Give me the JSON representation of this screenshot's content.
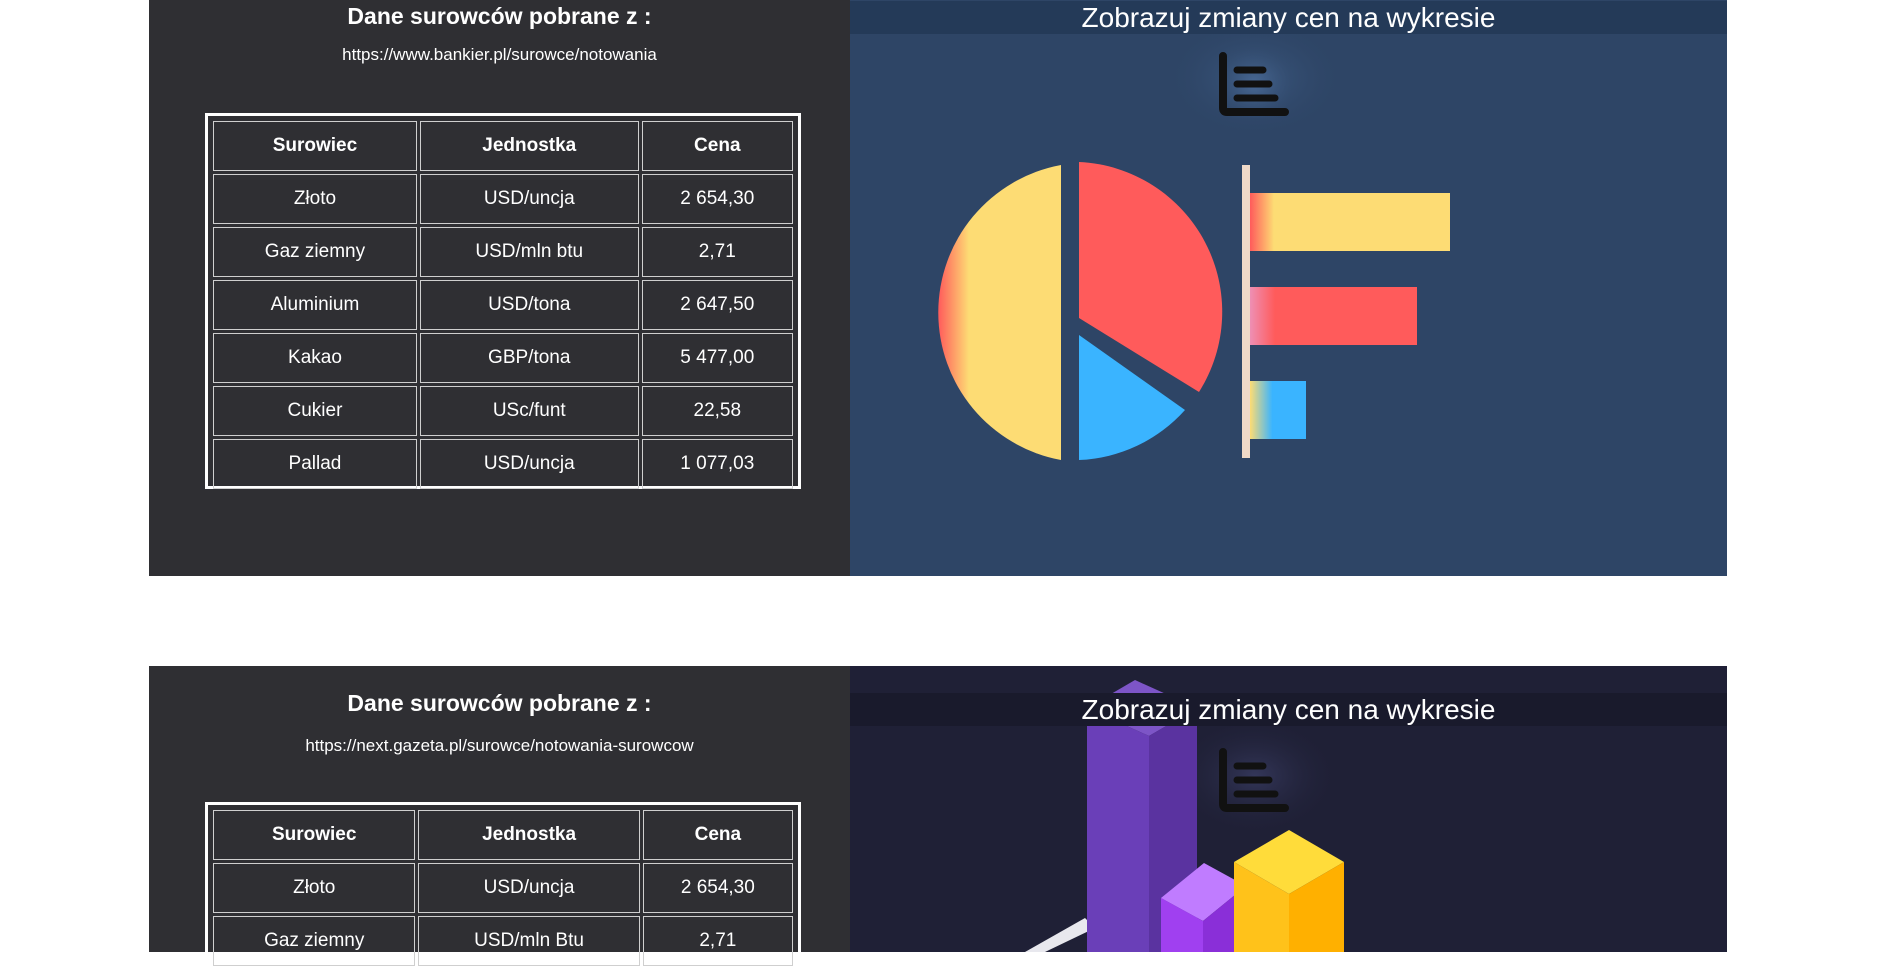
{
  "sections": [
    {
      "heading": "Dane surowców pobrane z :",
      "source": "https://www.bankier.pl/surowce/notowania",
      "table": {
        "headers": [
          "Surowiec",
          "Jednostka",
          "Cena"
        ],
        "rows": [
          [
            "Złoto",
            "USD/uncja",
            "2 654,30"
          ],
          [
            "Gaz ziemny",
            "USD/mln btu",
            "2,71"
          ],
          [
            "Aluminium",
            "USD/tona",
            "2 647,50"
          ],
          [
            "Kakao",
            "GBP/tona",
            "5 477,00"
          ],
          [
            "Cukier",
            "USc/funt",
            "22,58"
          ],
          [
            "Pallad",
            "USD/uncja",
            "1 077,03"
          ]
        ]
      },
      "chart_link": {
        "label": "Zobrazuj zmiany cen na wykresie",
        "icon": "chart-icon"
      }
    },
    {
      "heading": "Dane surowców pobrane z :",
      "source": "https://next.gazeta.pl/surowce/notowania-surowcow",
      "table": {
        "headers": [
          "Surowiec",
          "Jednostka",
          "Cena"
        ],
        "rows": [
          [
            "Złoto",
            "USD/uncja",
            "2 654,30"
          ],
          [
            "Gaz ziemny",
            "USD/mln Btu",
            "2,71"
          ]
        ]
      },
      "chart_link": {
        "label": "Zobrazuj zmiany cen na wykresie",
        "icon": "chart-icon"
      }
    }
  ],
  "colors": {
    "left_panel_bg": "#2f2f33",
    "right_panel_1_bg": "#2e4566",
    "right_panel_2_bg": "#1f2036"
  }
}
